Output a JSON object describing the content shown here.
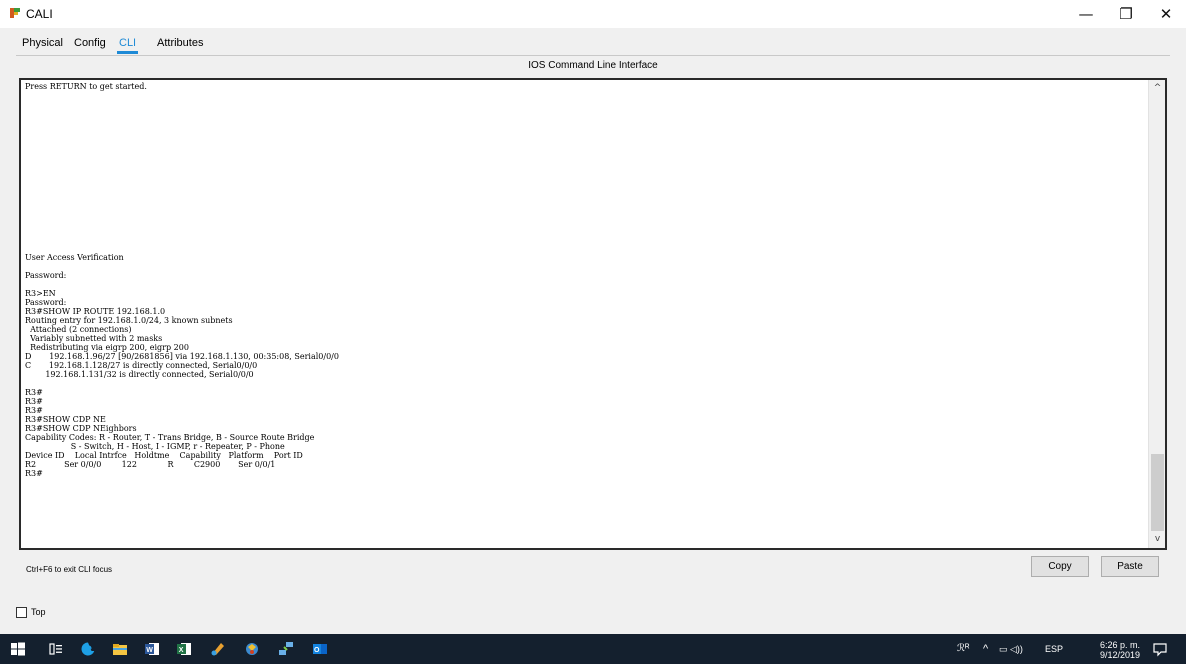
{
  "window": {
    "title": "CALI",
    "minimize_glyph": "—",
    "maximize_glyph": "❐",
    "close_glyph": "✕"
  },
  "tabs": [
    {
      "label": "Physical",
      "active": false
    },
    {
      "label": "Config",
      "active": false
    },
    {
      "label": "CLI",
      "active": true
    },
    {
      "label": "Attributes",
      "active": false
    }
  ],
  "cli": {
    "header": "IOS Command Line Interface",
    "console_text": "Press RETURN to get started.\n\n\n\n\n\n\n\n\n\n\n\n\n\n\n\n\n\n\nUser Access Verification\n\nPassword:\n\nR3>EN\nPassword:\nR3#SHOW IP ROUTE 192.168.1.0\nRouting entry for 192.168.1.0/24, 3 known subnets\n  Attached (2 connections)\n  Variably subnetted with 2 masks\n  Redistributing via eigrp 200, eigrp 200\nD       192.168.1.96/27 [90/2681856] via 192.168.1.130, 00:35:08, Serial0/0/0\nC       192.168.1.128/27 is directly connected, Serial0/0/0\n        192.168.1.131/32 is directly connected, Serial0/0/0\n\nR3#\nR3#\nR3#\nR3#SHOW CDP NE\nR3#SHOW CDP NEighbors\nCapability Codes: R - Router, T - Trans Bridge, B - Source Route Bridge\n                  S - Switch, H - Host, I - IGMP, r - Repeater, P - Phone\nDevice ID    Local Intrfce   Holdtme    Capability   Platform    Port ID\nR2           Ser 0/0/0        122            R        C2900       Ser 0/0/1\nR3#",
    "scroll_up_icon": "chevron-up-icon",
    "scroll_down_icon": "chevron-down-icon",
    "up_glyph": "^",
    "down_glyph": "v",
    "exit_hint": "Ctrl+F6 to exit CLI focus",
    "copy_label": "Copy",
    "paste_label": "Paste"
  },
  "top_checkbox": {
    "label": "Top",
    "checked": false
  },
  "taskbar": {
    "tray_people": "ℛᴿ",
    "tray_chevron": "^",
    "tray_icons": "▭ ◁))",
    "language": "ESP",
    "time": "6:26 p. m.",
    "date": "9/12/2019"
  },
  "colors": {
    "accent": "#1e8ad6",
    "taskbar": "#14202e",
    "window_bg": "#f0f0f0"
  }
}
